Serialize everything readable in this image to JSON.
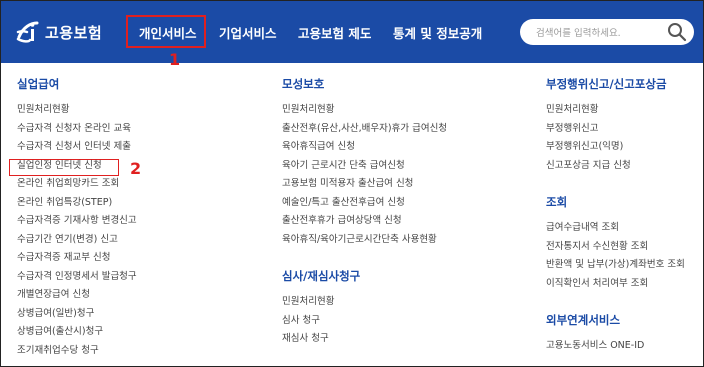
{
  "header": {
    "logo_text": "고용보험",
    "nav": [
      "개인서비스",
      "기업서비스",
      "고용보험 제도",
      "통계 및 정보공개"
    ],
    "search_placeholder": "검색어를 입력하세요.",
    "brand_color": "#1b4ba6"
  },
  "annotations": {
    "step1": "1",
    "step2": "2",
    "highlight_color": "#e02020"
  },
  "columns": {
    "col1": {
      "title": "실업급여",
      "items": [
        "민원처리현황",
        "수급자격 신청자 온라인 교육",
        "수급자격 신청서 인터넷 제출",
        "실업인정 인터넷 신청",
        "온라인 취업희망카드 조회",
        "온라인 취업특강(STEP)",
        "수급자격증 기재사항 변경신고",
        "수급기간 연기(변경) 신고",
        "수급자격증 재교부 신청",
        "수급자격 인정명세서 발급청구",
        "개별연장급여 신청",
        "상병급여(일반)청구",
        "상병급여(출산시)청구",
        "조기재취업수당 청구"
      ]
    },
    "col2": {
      "title": "모성보호",
      "items": [
        "민원처리현황",
        "출산전후(유산,사산,배우자)휴가 급여신청",
        "육아휴직급여 신청",
        "육아기 근로시간 단축 급여신청",
        "고용보험 미적용자 출산급여 신청",
        "예술인/특고 출산전후급여 신청",
        "출산전후휴가 급여상당액 신청",
        "육아휴직/육아기근로시간단축 사용현황"
      ],
      "title2": "심사/재심사청구",
      "items2": [
        "민원처리현황",
        "심사 청구",
        "재심사 청구"
      ]
    },
    "col3": {
      "title": "부정행위신고/신고포상금",
      "items": [
        "민원처리현황",
        "부정행위신고",
        "부정행위신고(익명)",
        "신고포상금 지급 신청"
      ],
      "title2": "조회",
      "items2": [
        "급여수급내역 조회",
        "전자통지서 수신현황 조회",
        "반환액 및 납부(가상)계좌번호 조회",
        "이직확인서 처리여부 조회"
      ],
      "title3": "외부연계서비스",
      "items3": [
        "고용노동서비스 ONE-ID"
      ]
    }
  }
}
